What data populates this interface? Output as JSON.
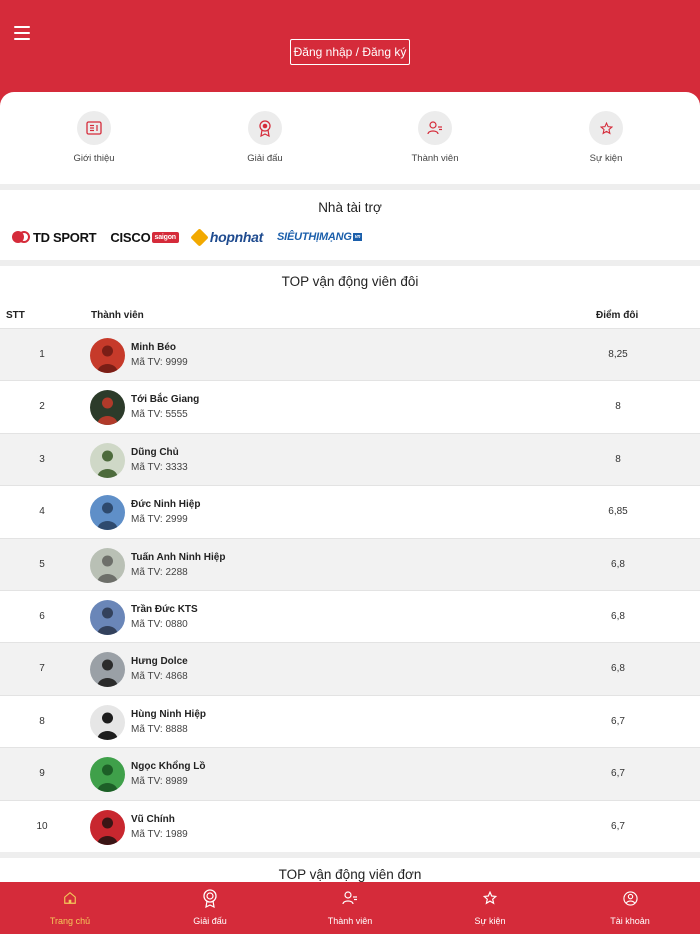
{
  "header": {
    "login_label": "Đăng nhập / Đăng ký"
  },
  "categories": [
    {
      "label": "Giới thiệu",
      "icon": "newspaper-icon"
    },
    {
      "label": "Giải đấu",
      "icon": "medal-icon"
    },
    {
      "label": "Thành viên",
      "icon": "members-icon"
    },
    {
      "label": "Sự kiện",
      "icon": "star-icon"
    }
  ],
  "sponsors": {
    "title": "Nhà tài trợ",
    "logos": [
      "TD SPORT",
      "CISCO",
      "saigon",
      "hopnhat",
      "SIÊUTHỊMẠNG",
      "vn"
    ]
  },
  "ranking": {
    "title": "TOP vận động viên đôi",
    "headers": {
      "rank": "STT",
      "member": "Thành viên",
      "score": "Điểm đôi"
    },
    "code_prefix": "Mã TV:",
    "rows": [
      {
        "rank": "1",
        "name": "Minh Béo",
        "code": "Mã TV: 9999",
        "score": "8,25"
      },
      {
        "rank": "2",
        "name": "Tới Bắc Giang",
        "code": "Mã TV: 5555",
        "score": "8"
      },
      {
        "rank": "3",
        "name": "Dũng Chủ",
        "code": "Mã TV: 3333",
        "score": "8"
      },
      {
        "rank": "4",
        "name": "Đức Ninh Hiệp",
        "code": "Mã TV: 2999",
        "score": "6,85"
      },
      {
        "rank": "5",
        "name": "Tuấn Anh Ninh Hiệp",
        "code": "Mã TV: 2288",
        "score": "6,8"
      },
      {
        "rank": "6",
        "name": "Trần Đức KTS",
        "code": "Mã TV: 0880",
        "score": "6,8"
      },
      {
        "rank": "7",
        "name": "Hưng Dolce",
        "code": "Mã TV: 4868",
        "score": "6,8"
      },
      {
        "rank": "8",
        "name": "Hùng Ninh Hiệp",
        "code": "Mã TV: 8888",
        "score": "6,7"
      },
      {
        "rank": "9",
        "name": "Ngọc Khổng Lồ",
        "code": "Mã TV: 8989",
        "score": "6,7"
      },
      {
        "rank": "10",
        "name": "Vũ Chính",
        "code": "Mã TV: 1989",
        "score": "6,7"
      }
    ]
  },
  "single_ranking": {
    "title": "TOP vận động viên đơn"
  },
  "bottom_nav": [
    {
      "label": "Trang chủ",
      "icon": "home-icon",
      "active": true
    },
    {
      "label": "Giải đấu",
      "icon": "medal-icon",
      "active": false
    },
    {
      "label": "Thành viên",
      "icon": "members-icon",
      "active": false
    },
    {
      "label": "Sự kiện",
      "icon": "star-icon",
      "active": false
    },
    {
      "label": "Tài khoản",
      "icon": "account-icon",
      "active": false
    }
  ],
  "colors": {
    "brand": "#d52b3a",
    "active_nav": "#f3c85a",
    "row_alt": "#f2f2f2"
  }
}
